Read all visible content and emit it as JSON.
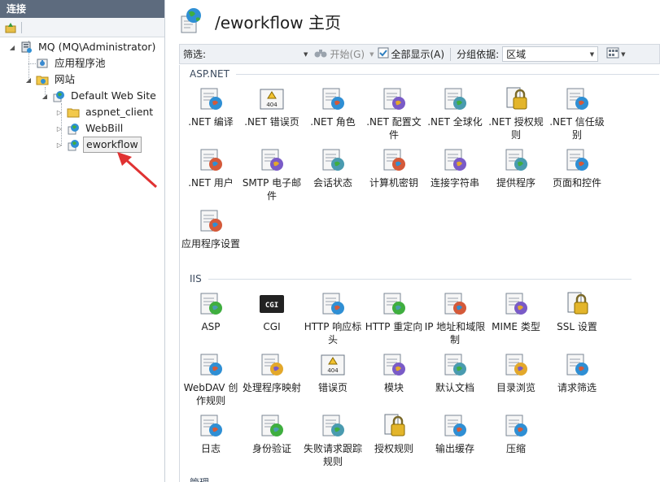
{
  "left": {
    "header": "连接",
    "tree": [
      {
        "label": "MQ (MQ\\Administrator)",
        "icon": "server-icon"
      },
      {
        "label": "应用程序池",
        "icon": "app-pool-icon"
      },
      {
        "label": "网站",
        "icon": "sites-folder-icon"
      },
      {
        "label": "Default Web Site",
        "icon": "globe-icon"
      },
      {
        "label": "aspnet_client",
        "icon": "folder-icon"
      },
      {
        "label": "WebBill",
        "icon": "globe-icon"
      },
      {
        "label": "eworkflow",
        "icon": "globe-icon"
      }
    ]
  },
  "main": {
    "title": "/eworkflow 主页",
    "filter": {
      "label": "筛选:",
      "start": "开始(G)",
      "show_all": "全部显示(A)",
      "group_by_label": "分组依据:",
      "group_by_value": "区域"
    },
    "groups": {
      "aspnet": {
        "name": "ASP.NET",
        "items": [
          {
            "label": ".NET 编译",
            "icon": "net-compile-icon"
          },
          {
            "label": ".NET 错误页",
            "icon": "net-error-pages-icon"
          },
          {
            "label": ".NET 角色",
            "icon": "net-roles-icon"
          },
          {
            "label": ".NET 配置文件",
            "icon": "net-profile-icon"
          },
          {
            "label": ".NET 全球化",
            "icon": "net-globalization-icon"
          },
          {
            "label": ".NET 授权规则",
            "icon": "net-authorization-icon"
          },
          {
            "label": ".NET 信任级别",
            "icon": "net-trust-icon"
          },
          {
            "label": ".NET 用户",
            "icon": "net-users-icon"
          },
          {
            "label": "SMTP 电子邮件",
            "icon": "smtp-email-icon"
          },
          {
            "label": "会话状态",
            "icon": "session-state-icon"
          },
          {
            "label": "计算机密钥",
            "icon": "machine-key-icon"
          },
          {
            "label": "连接字符串",
            "icon": "connection-strings-icon"
          },
          {
            "label": "提供程序",
            "icon": "providers-icon"
          },
          {
            "label": "页面和控件",
            "icon": "pages-controls-icon"
          },
          {
            "label": "应用程序设置",
            "icon": "app-settings-icon"
          }
        ]
      },
      "iis": {
        "name": "IIS",
        "items": [
          {
            "label": "ASP",
            "icon": "asp-icon"
          },
          {
            "label": "CGI",
            "icon": "cgi-icon"
          },
          {
            "label": "HTTP 响应标头",
            "icon": "http-headers-icon"
          },
          {
            "label": "HTTP 重定向",
            "icon": "http-redirect-icon"
          },
          {
            "label": "IP 地址和域限制",
            "icon": "ip-restrictions-icon"
          },
          {
            "label": "MIME 类型",
            "icon": "mime-types-icon"
          },
          {
            "label": "SSL 设置",
            "icon": "ssl-lock-icon"
          },
          {
            "label": "WebDAV 创作规则",
            "icon": "webdav-icon"
          },
          {
            "label": "处理程序映射",
            "icon": "handler-mappings-icon"
          },
          {
            "label": "错误页",
            "icon": "error-pages-icon"
          },
          {
            "label": "模块",
            "icon": "modules-icon"
          },
          {
            "label": "默认文档",
            "icon": "default-document-icon"
          },
          {
            "label": "目录浏览",
            "icon": "directory-browsing-icon"
          },
          {
            "label": "请求筛选",
            "icon": "request-filtering-icon"
          },
          {
            "label": "日志",
            "icon": "logging-icon"
          },
          {
            "label": "身份验证",
            "icon": "authentication-icon"
          },
          {
            "label": "失败请求跟踪规则",
            "icon": "failed-request-tracing-icon"
          },
          {
            "label": "授权规则",
            "icon": "authorization-rules-icon"
          },
          {
            "label": "输出缓存",
            "icon": "output-caching-icon"
          },
          {
            "label": "压缩",
            "icon": "compression-icon"
          }
        ]
      },
      "management": {
        "name": "管理"
      }
    }
  },
  "colors": {
    "header_bg": "#5d6b7e",
    "group_header": "#3b4a5e",
    "annotation_arrow": "#e03232"
  }
}
